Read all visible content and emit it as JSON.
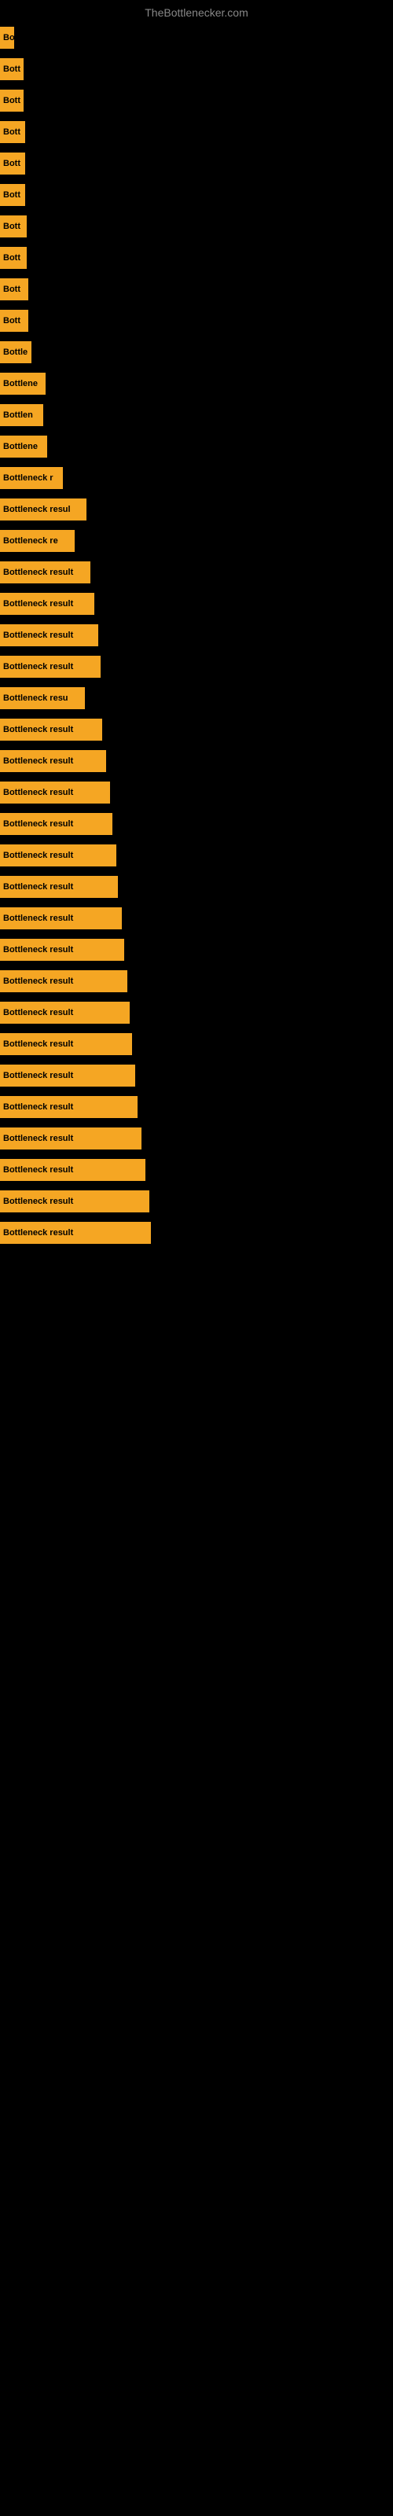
{
  "site_title": "TheBottlenecker.com",
  "bars": [
    {
      "label": "Bo",
      "width": 18
    },
    {
      "label": "Bott",
      "width": 30
    },
    {
      "label": "Bott",
      "width": 30
    },
    {
      "label": "Bott",
      "width": 32
    },
    {
      "label": "Bott",
      "width": 32
    },
    {
      "label": "Bott",
      "width": 32
    },
    {
      "label": "Bott",
      "width": 34
    },
    {
      "label": "Bott",
      "width": 34
    },
    {
      "label": "Bott",
      "width": 36
    },
    {
      "label": "Bott",
      "width": 36
    },
    {
      "label": "Bottle",
      "width": 40
    },
    {
      "label": "Bottlene",
      "width": 58
    },
    {
      "label": "Bottlen",
      "width": 55
    },
    {
      "label": "Bottlene",
      "width": 60
    },
    {
      "label": "Bottleneck r",
      "width": 80
    },
    {
      "label": "Bottleneck resul",
      "width": 110
    },
    {
      "label": "Bottleneck re",
      "width": 95
    },
    {
      "label": "Bottleneck result",
      "width": 115
    },
    {
      "label": "Bottleneck result",
      "width": 120
    },
    {
      "label": "Bottleneck result",
      "width": 125
    },
    {
      "label": "Bottleneck result",
      "width": 128
    },
    {
      "label": "Bottleneck resu",
      "width": 108
    },
    {
      "label": "Bottleneck result",
      "width": 130
    },
    {
      "label": "Bottleneck result",
      "width": 135
    },
    {
      "label": "Bottleneck result",
      "width": 140
    },
    {
      "label": "Bottleneck result",
      "width": 143
    },
    {
      "label": "Bottleneck result",
      "width": 148
    },
    {
      "label": "Bottleneck result",
      "width": 150
    },
    {
      "label": "Bottleneck result",
      "width": 155
    },
    {
      "label": "Bottleneck result",
      "width": 158
    },
    {
      "label": "Bottleneck result",
      "width": 162
    },
    {
      "label": "Bottleneck result",
      "width": 165
    },
    {
      "label": "Bottleneck result",
      "width": 168
    },
    {
      "label": "Bottleneck result",
      "width": 172
    },
    {
      "label": "Bottleneck result",
      "width": 175
    },
    {
      "label": "Bottleneck result",
      "width": 180
    },
    {
      "label": "Bottleneck result",
      "width": 185
    },
    {
      "label": "Bottleneck result",
      "width": 190
    },
    {
      "label": "Bottleneck result",
      "width": 192
    }
  ]
}
